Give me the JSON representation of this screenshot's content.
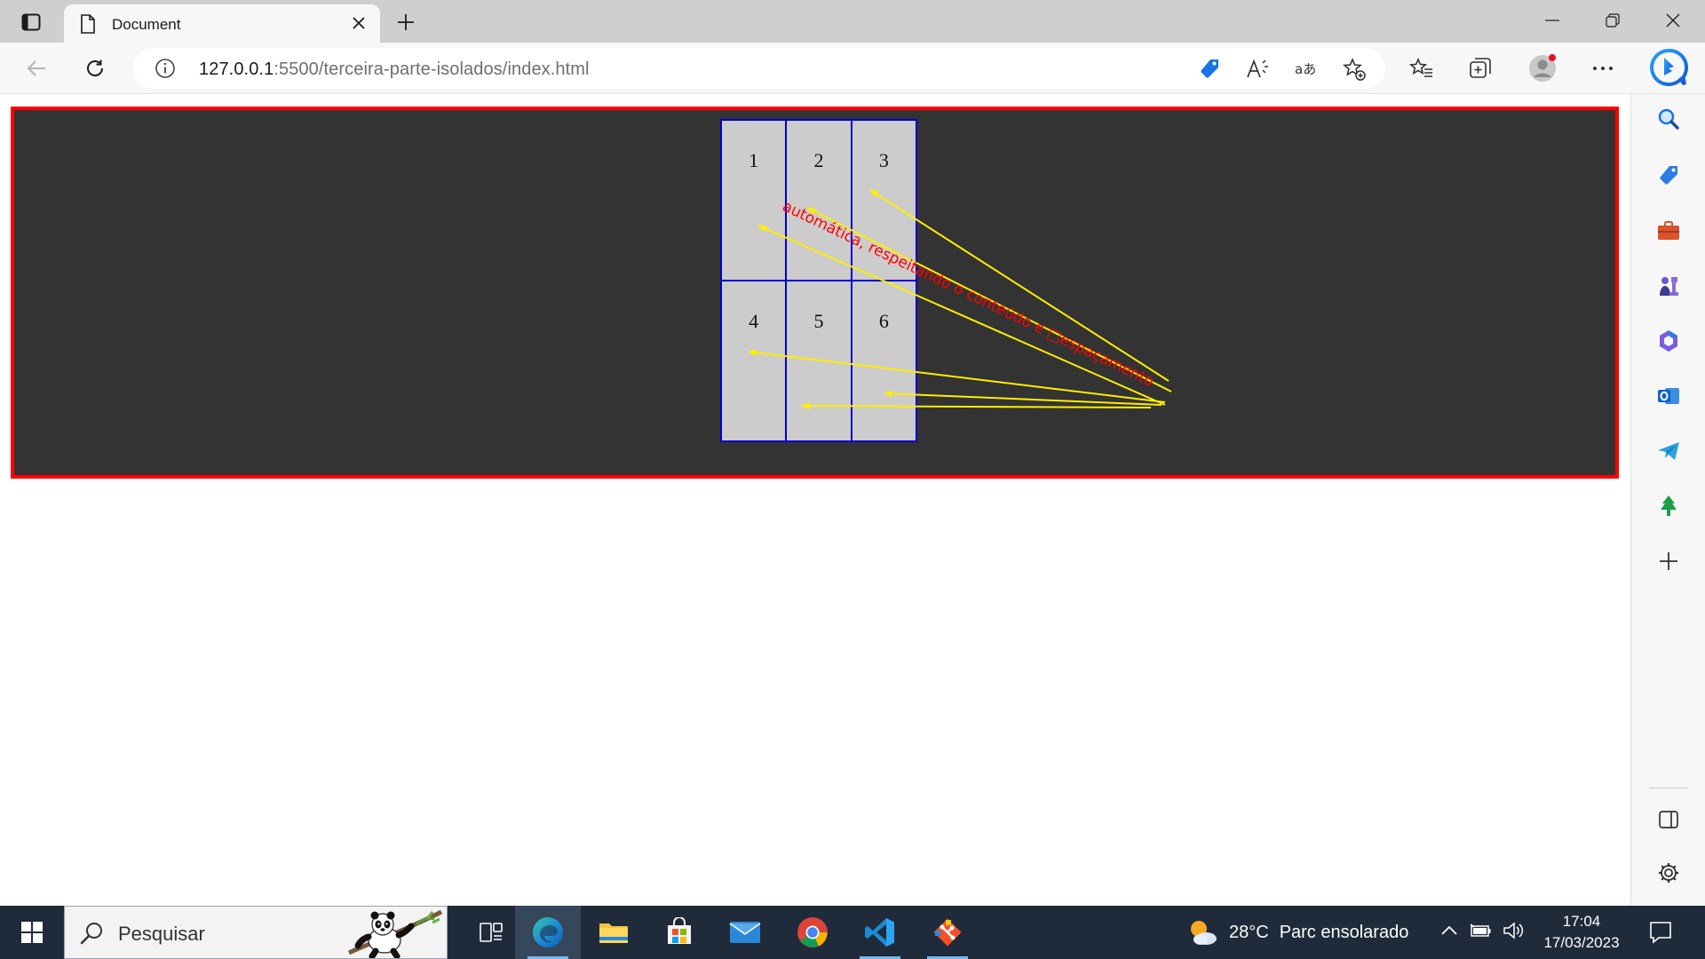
{
  "browser": {
    "tab_title": "Document",
    "url_host": "127.0.0.1",
    "url_rest": ":5500/terceira-parte-isolados/index.html"
  },
  "page": {
    "cells": [
      "1",
      "2",
      "3",
      "4",
      "5",
      "6"
    ],
    "annotation": "automática, respeitando o conteúdo e □espaçamento",
    "colors": {
      "frame_border": "#ff0000",
      "frame_bg": "#333333",
      "cell_bg": "#cccccc",
      "cell_border": "#0000cc",
      "arrow": "#ffee00",
      "annotation": "#ff0000"
    }
  },
  "taskbar": {
    "search_placeholder": "Pesquisar",
    "weather_temp": "28°C",
    "weather_condition": "Parc ensolarado",
    "time": "17:04",
    "date": "17/03/2023"
  },
  "icons": {
    "toolbar": [
      "back-icon",
      "refresh-icon",
      "info-icon",
      "coupon-tag-icon",
      "read-aloud-icon",
      "translate-icon",
      "add-favorite-icon",
      "favorites-icon",
      "collections-icon",
      "profile-icon",
      "more-icon",
      "bing-icon"
    ],
    "sidebar": [
      "search-icon",
      "shopping-icon",
      "tools-icon",
      "games-icon",
      "office-icon",
      "outlook-icon",
      "telegram-icon",
      "tree-icon",
      "add-icon",
      "sidebar-toggle-icon",
      "settings-icon"
    ],
    "taskbar": [
      "windows-icon",
      "search-icon",
      "task-view-icon",
      "edge-icon",
      "file-explorer-icon",
      "store-icon",
      "mail-icon",
      "chrome-icon",
      "vscode-icon",
      "git-icon"
    ]
  }
}
